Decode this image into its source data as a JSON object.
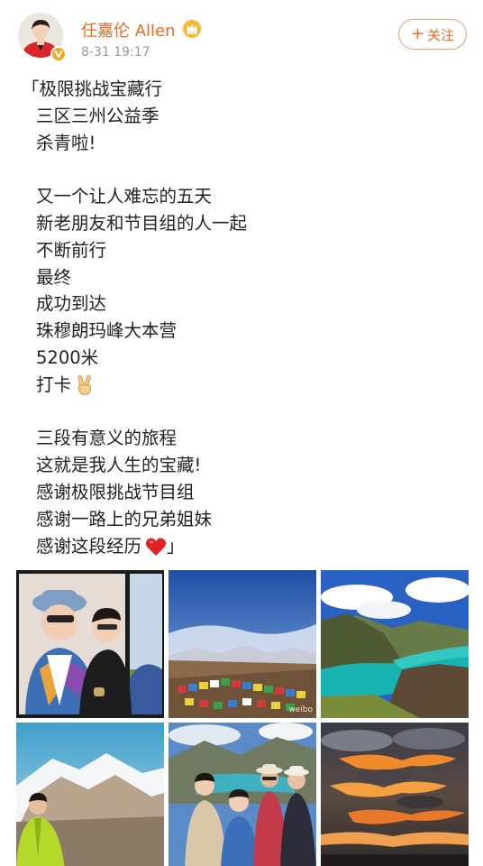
{
  "header": {
    "username": "任嘉伦 Allen",
    "timestamp": "8-31 19:17",
    "follow_label": "关注",
    "follow_plus": "+"
  },
  "post": {
    "lines": [
      "「极限挑战宝藏行",
      "三区三州公益季",
      "杀青啦!",
      "",
      "又一个让人难忘的五天",
      "新老朋友和节目组的人一起",
      "不断前行",
      "最终",
      "成功到达",
      "珠穆朗玛峰大本营",
      "5200米",
      "打卡",
      "",
      "三段有意义的旅程",
      "这就是我人生的宝藏!",
      "感谢极限挑战节目组",
      "感谢一路上的兄弟姐妹",
      "感谢这段经历",
      "」"
    ]
  },
  "colors": {
    "username": "#f06b1f",
    "follow_border": "#e8a06e",
    "timestamp": "#9a9a9a",
    "text": "#222222",
    "heart": "#e02424"
  },
  "icons": {
    "vip": "vip-badge-icon",
    "crown": "crown-badge-icon",
    "victory": "victory-hand-emoji",
    "heart": "red-heart-emoji"
  },
  "photos": {
    "watermark_2": "weibo"
  }
}
